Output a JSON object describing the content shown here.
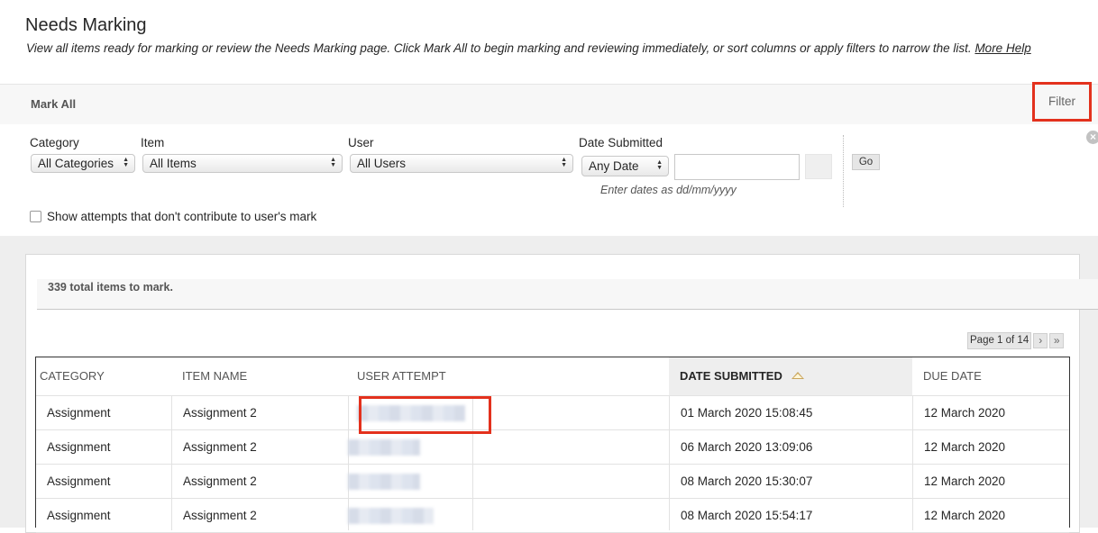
{
  "header": {
    "title": "Needs Marking",
    "description": "View all items ready for marking or review the Needs Marking page. Click Mark All to begin marking and reviewing immediately, or sort columns or apply filters to narrow the list.",
    "help_link": "More Help"
  },
  "action_bar": {
    "mark_all": "Mark All",
    "filter": "Filter"
  },
  "filters": {
    "category_label": "Category",
    "category_value": "All Categories",
    "item_label": "Item",
    "item_value": "All Items",
    "user_label": "User",
    "user_value": "All Users",
    "date_label": "Date Submitted",
    "date_value": "Any Date",
    "date_hint": "Enter dates as dd/mm/yyyy",
    "go": "Go",
    "show_attempts_label": "Show attempts that don't contribute to user's mark"
  },
  "summary": {
    "total_text": "339 total items to mark."
  },
  "pager": {
    "text": "Page 1 of 14",
    "next": "›",
    "last": "»"
  },
  "table": {
    "columns": [
      "CATEGORY",
      "ITEM NAME",
      "USER ATTEMPT",
      "DATE SUBMITTED",
      "DUE DATE"
    ],
    "rows": [
      {
        "category": "Assignment",
        "item": "Assignment 2",
        "submitted": "01 March 2020 15:08:45",
        "due": "12 March 2020"
      },
      {
        "category": "Assignment",
        "item": "Assignment 2",
        "submitted": "06 March 2020 13:09:06",
        "due": "12 March 2020"
      },
      {
        "category": "Assignment",
        "item": "Assignment 2",
        "submitted": "08 March 2020 15:30:07",
        "due": "12 March 2020"
      },
      {
        "category": "Assignment",
        "item": "Assignment 2",
        "submitted": "08 March 2020 15:54:17",
        "due": "12 March 2020"
      }
    ]
  },
  "colors": {
    "highlight": "#e3311d",
    "sort_arrow": "#c9a55c"
  }
}
